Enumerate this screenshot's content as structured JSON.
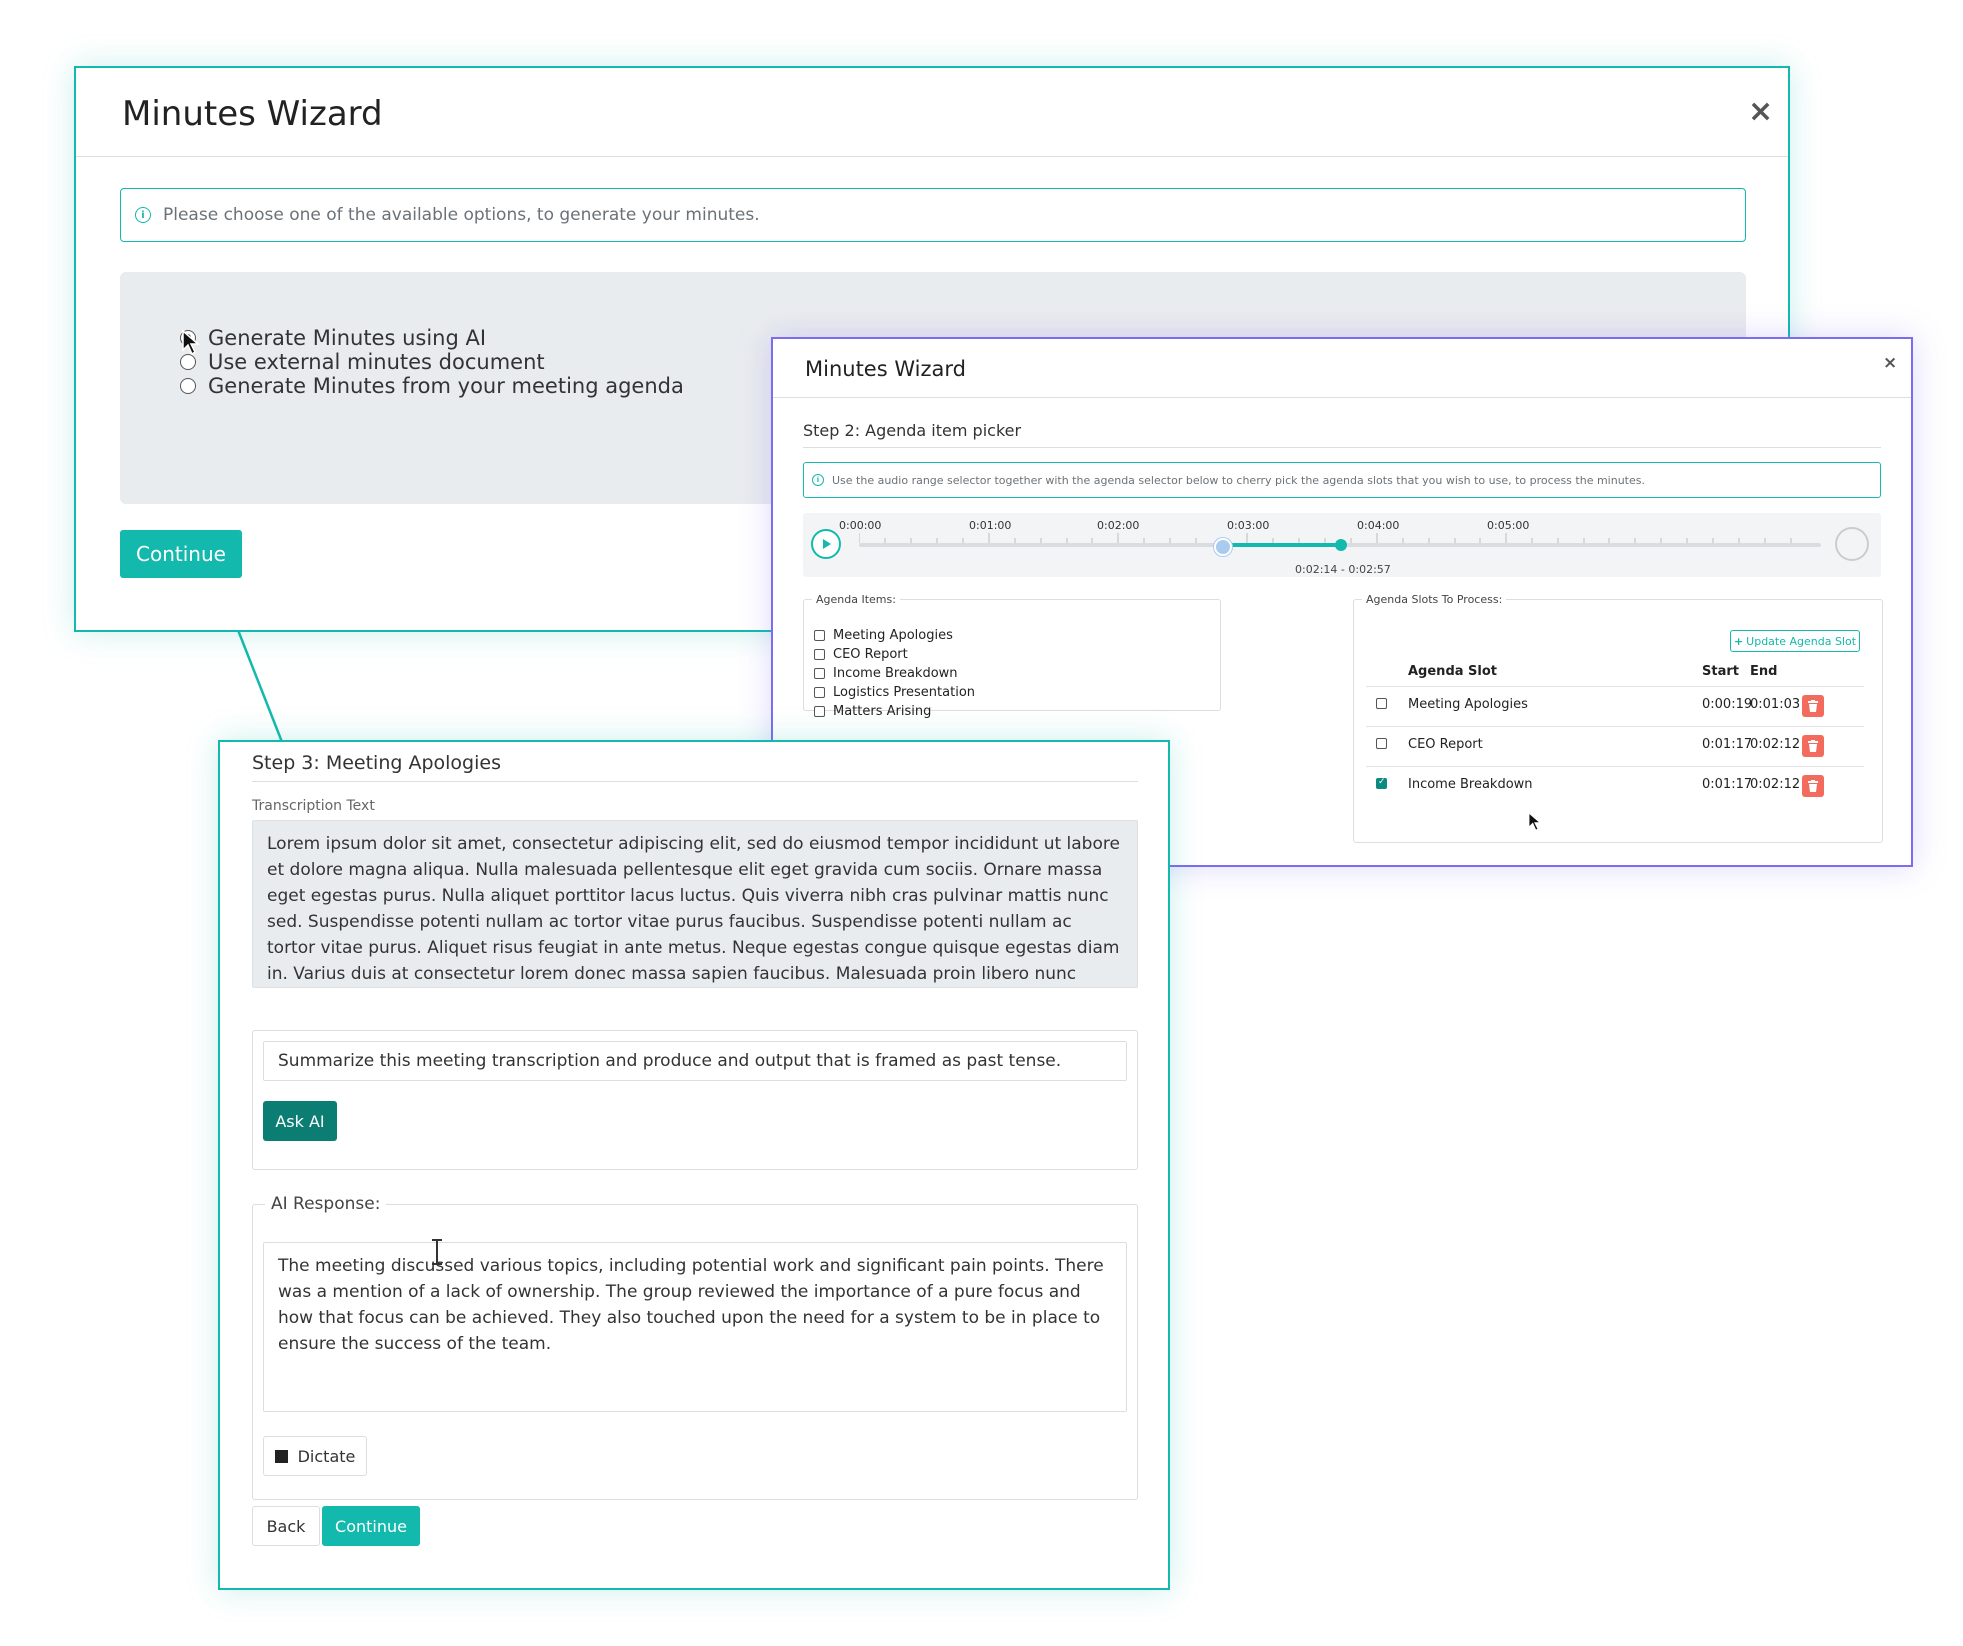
{
  "window1": {
    "title": "Minutes Wizard",
    "close": "×",
    "info_text": "Please choose one of the available options, to generate your minutes.",
    "options": [
      {
        "label": "Generate Minutes using AI",
        "selected": true
      },
      {
        "label": "Use external minutes document",
        "selected": false
      },
      {
        "label": "Generate Minutes from your meeting agenda",
        "selected": false
      }
    ],
    "continue_label": "Continue"
  },
  "window2": {
    "title": "Minutes Wizard",
    "close": "×",
    "step_title": "Step 2: Agenda item picker",
    "info_text": "Use the audio range selector together with the agenda selector below to cherry pick the agenda slots that you wish to use, to process the minutes.",
    "audio": {
      "ticks": [
        "0:00:00",
        "0:01:00",
        "0:02:00",
        "0:03:00",
        "0:04:00",
        "0:05:00"
      ],
      "range_label": "0:02:14 - 0:02:57"
    },
    "agenda_items_legend": "Agenda Items:",
    "agenda_items": [
      "Meeting Apologies",
      "CEO Report",
      "Income Breakdown",
      "Logistics Presentation",
      "Matters Arising"
    ],
    "slots_legend": "Agenda Slots To Process:",
    "update_button": "Update Agenda Slot",
    "slot_headers": {
      "slot": "Agenda Slot",
      "start": "Start",
      "end": "End"
    },
    "slots": [
      {
        "name": "Meeting Apologies",
        "start": "0:00:19",
        "end": "0:01:03",
        "checked": false
      },
      {
        "name": "CEO Report",
        "start": "0:01:17",
        "end": "0:02:12",
        "checked": false
      },
      {
        "name": "Income Breakdown",
        "start": "0:01:17",
        "end": "0:02:12",
        "checked": true
      }
    ]
  },
  "window3": {
    "step_title": "Step 3: Meeting Apologies",
    "transcription_label": "Transcription Text",
    "transcription_text": "Lorem ipsum dolor sit amet, consectetur adipiscing elit, sed do eiusmod tempor incididunt ut labore et dolore magna aliqua. Nulla malesuada pellentesque elit eget gravida cum sociis. Ornare massa eget egestas purus. Nulla aliquet porttitor lacus luctus. Quis viverra nibh cras pulvinar mattis nunc sed. Suspendisse potenti nullam ac tortor vitae purus faucibus. Suspendisse potenti nullam ac tortor vitae purus. Aliquet risus feugiat in ante metus. Neque egestas congue quisque egestas diam in. Varius duis at consectetur lorem donec massa sapien faucibus. Malesuada proin libero nunc consequat interd",
    "prompt_value": "Summarize this meeting transcription and produce and output that is framed as past tense.",
    "ask_label": "Ask AI",
    "response_legend": "AI Response:",
    "response_text": "The meeting discussed various topics, including potential work and significant pain points. There was a mention of a lack of ownership. The group reviewed the importance of a pure focus and how that focus can be achieved. They also touched upon the need for a system to be in place to ensure the success of the team.",
    "dictate_label": "Dictate",
    "back_label": "Back",
    "continue_label": "Continue"
  },
  "colors": {
    "teal": "#13b9ac",
    "dark_teal": "#0c7d73",
    "purple": "#7b6cf0",
    "danger": "#f36b5d"
  }
}
